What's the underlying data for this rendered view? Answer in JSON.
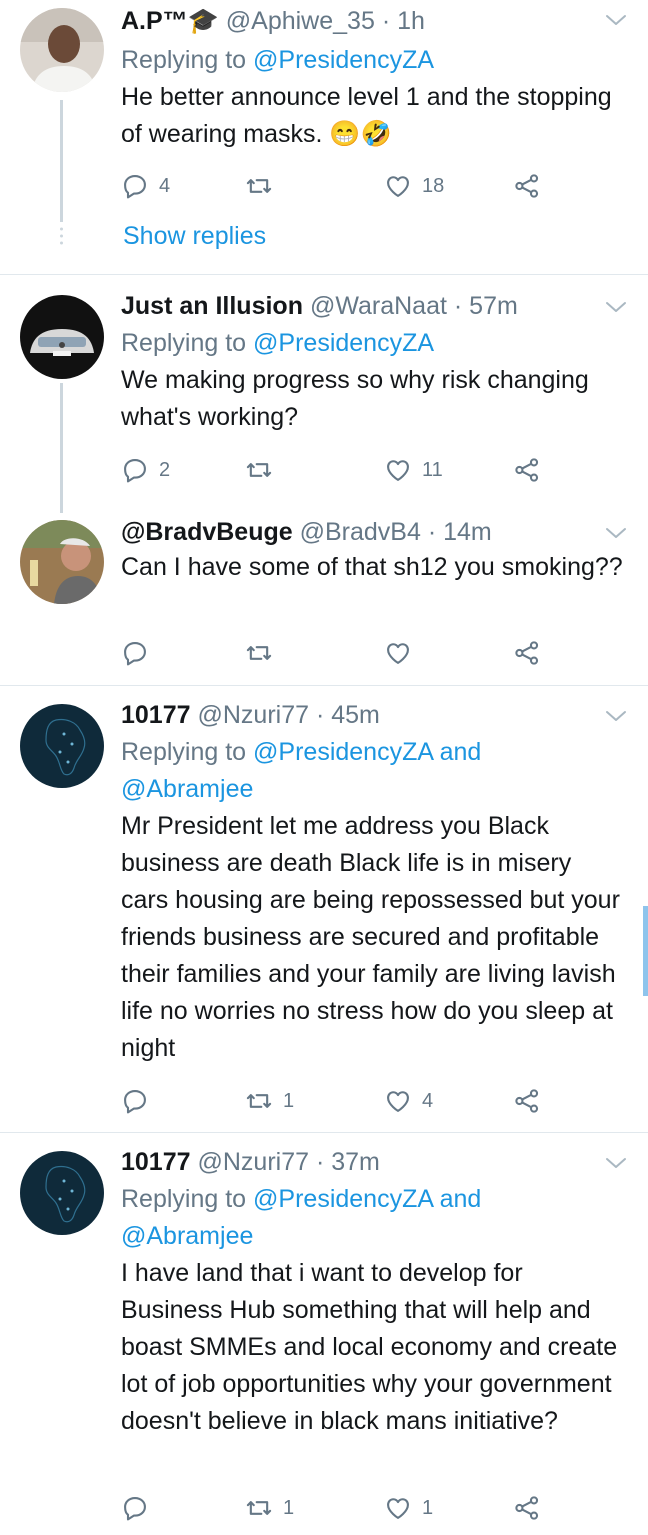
{
  "tweets": [
    {
      "name": "A.P™🎓",
      "handle": "@Aphiwe_35",
      "time": "· 1h",
      "replying_label": "Replying to",
      "replying_to": "@PresidencyZA",
      "replying_extra": "",
      "text": "He better announce level 1 and the stopping of wearing masks. 😁🤣",
      "replies": "4",
      "retweets": "",
      "likes": "18",
      "show_replies": "Show replies"
    },
    {
      "name": "Just an Illusion",
      "handle": "@WaraNaat",
      "time": "· 57m",
      "replying_label": "Replying to",
      "replying_to": "@PresidencyZA",
      "replying_extra": "",
      "text": "We making progress so why risk changing what's working?",
      "replies": "2",
      "retweets": "",
      "likes": "11"
    },
    {
      "name": "@BradvBeuge",
      "handle": "@BradvB4",
      "time": "· 14m",
      "text": "Can I have some of that sh12 you smoking??",
      "replies": "",
      "retweets": "",
      "likes": ""
    },
    {
      "name": "10177",
      "handle": "@Nzuri77",
      "time": "· 45m",
      "replying_label": "Replying to",
      "replying_to": "@PresidencyZA and",
      "replying_extra": "@Abramjee",
      "text": "Mr President let me address you Black business are death Black life is in misery cars housing are being repossessed but your friends business are secured and profitable their families and your family are living lavish life no worries no stress how do you sleep at night",
      "replies": "",
      "retweets": "1",
      "likes": "4"
    },
    {
      "name": "10177",
      "handle": "@Nzuri77",
      "time": "· 37m",
      "replying_label": "Replying to",
      "replying_to": "@PresidencyZA and",
      "replying_extra": "@Abramjee",
      "text": "I have land that i want to develop for Business Hub something that will help and boast SMMEs and local economy and create lot of job opportunities why your government doesn't believe in black mans initiative?",
      "replies": "",
      "retweets": "1",
      "likes": "1"
    }
  ],
  "colors": {
    "accent": "#1b95e0",
    "muted": "#657786",
    "divider": "#e1e8ed"
  },
  "icons": [
    "reply-icon",
    "retweet-icon",
    "like-icon",
    "share-icon",
    "chevron-down-icon"
  ]
}
